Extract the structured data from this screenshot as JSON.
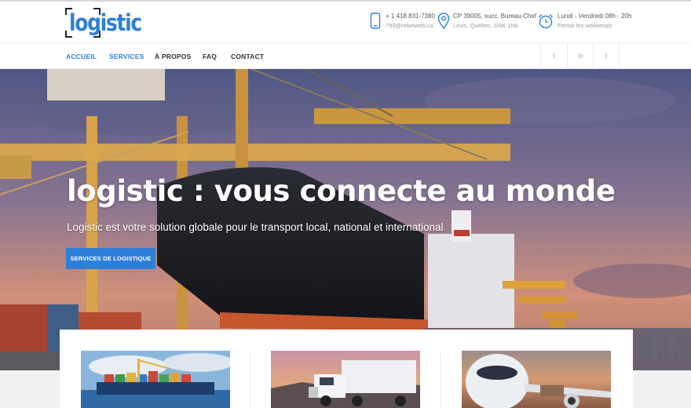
{
  "brand": {
    "logo_text": "logistic",
    "accent": "#2e7fd8"
  },
  "header": {
    "phone": {
      "icon": "phone-icon",
      "line1": "+ 1 418 831-7380",
      "line2": "799@rebelweb.ca"
    },
    "address": {
      "icon": "location-pin-icon",
      "line1": "CP 39005, succ. Bureau-Chef",
      "line2": "Lévis, Québec, G6K 1N6"
    },
    "hours": {
      "icon": "alarm-clock-icon",
      "line1": "Lundi - Vendredi 08h - 20h",
      "line2": "Fermé les weekends"
    }
  },
  "nav": {
    "items": [
      {
        "label": "ACCUEIL",
        "active": true
      },
      {
        "label": "SERVICES",
        "active": true
      },
      {
        "label": "À PROPOS",
        "active": false
      },
      {
        "label": "FAQ",
        "active": false
      },
      {
        "label": "CONTACT",
        "active": false
      }
    ],
    "social": [
      {
        "icon": "facebook-icon",
        "glyph": "f"
      },
      {
        "icon": "linkedin-icon",
        "glyph": "in"
      },
      {
        "icon": "twitter-icon",
        "glyph": "t"
      }
    ]
  },
  "hero": {
    "title": "logistic : vous connecte au monde",
    "subtitle": "Logistic est votre solution globale pour le transport local, national et international",
    "button_label": "SERVICES DE LOGISTIQUE"
  },
  "cards": [
    {
      "image": "cargo-ship-photo"
    },
    {
      "image": "truck-photo"
    },
    {
      "image": "airplane-photo"
    }
  ]
}
